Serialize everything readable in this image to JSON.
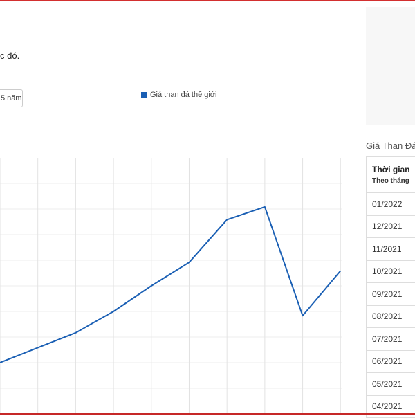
{
  "intro": {
    "text": "c đó."
  },
  "controls": {
    "period_label": "5 năm"
  },
  "legend": {
    "series_name": "Giá than đá thế giới",
    "color": "#1a5fb4"
  },
  "table": {
    "title": "Giá Than Đá",
    "header_main": "Thời gian",
    "header_sub": "Theo tháng",
    "rows": [
      "01/2022",
      "12/2021",
      "11/2021",
      "10/2021",
      "09/2021",
      "08/2021",
      "07/2021",
      "06/2021",
      "05/2021",
      "04/2021"
    ]
  },
  "chart_data": {
    "type": "line",
    "grid": true,
    "series": [
      {
        "name": "Giá than đá thế giới",
        "color": "#1a5fb4",
        "points": [
          [
            -2,
            24
          ],
          [
            0,
            38
          ],
          [
            1,
            48
          ],
          [
            2,
            60
          ],
          [
            3,
            71
          ],
          [
            4,
            91
          ],
          [
            5,
            97
          ],
          [
            6,
            46
          ],
          [
            7,
            67
          ]
        ]
      }
    ],
    "xlim": [
      -2,
      7.05
    ],
    "ylim": [
      0,
      120
    ]
  }
}
